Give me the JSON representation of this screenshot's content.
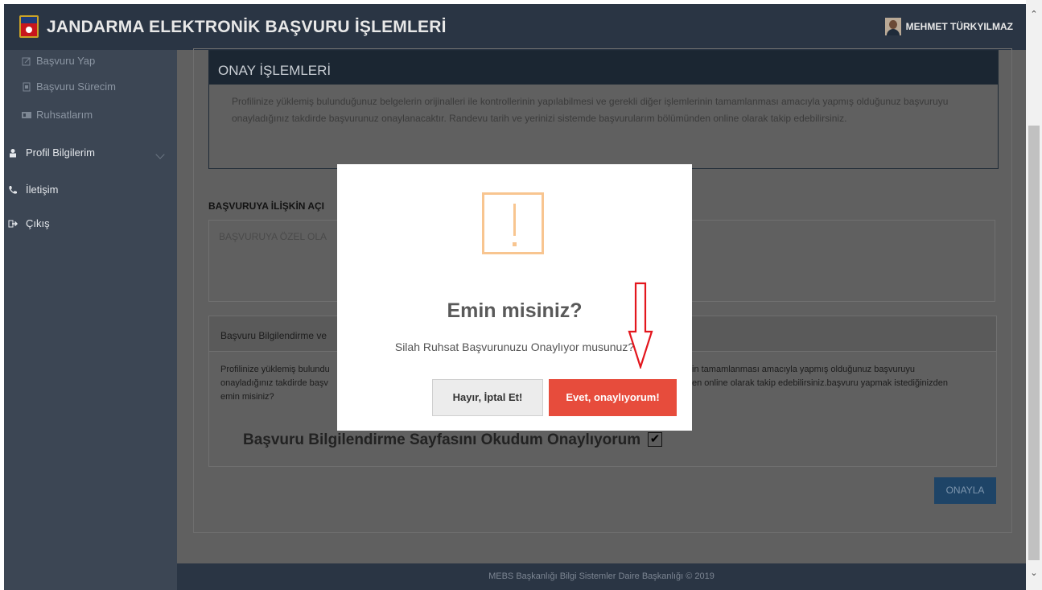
{
  "header": {
    "title": "JANDARMA ELEKTRONİK BAŞVURU İŞLEMLERİ",
    "user_name": "MEHMET TÜRKYILMAZ"
  },
  "sidebar": {
    "sub_items": [
      {
        "label": "Başvuru Yap",
        "icon": "edit-icon"
      },
      {
        "label": "Başvuru Sürecim",
        "icon": "file-icon"
      },
      {
        "label": "Ruhsatlarım",
        "icon": "id-card-icon"
      }
    ],
    "main_items": [
      {
        "label": "Profil Bilgilerim",
        "icon": "user-icon"
      },
      {
        "label": "İletişim",
        "icon": "phone-icon"
      },
      {
        "label": "Çıkış",
        "icon": "sign-out-icon"
      }
    ]
  },
  "main": {
    "onay_title": "ONAY İŞLEMLERİ",
    "onay_text": "Profilinize yüklemiş bulunduğunuz belgelerin orijinalleri ile kontrollerinin yapılabilmesi ve gerekli diğer işlemlerinin tamamlanması amacıyla yapmış olduğunuz başvuruyu onayladığınız takdirde başvurunuz onaylanacaktır. Randevu tarih ve yerinizi sistemde başvurularım bölümünden online olarak takip edebilirsiniz.",
    "aciklama_label": "BAŞVURUYA İLİŞKİN AÇI",
    "aciklama_placeholder": "BAŞVURUYA ÖZEL OLA",
    "bilgi_title": "Başvuru Bilgilendirme ve",
    "bilgi_text_left_1": "Profilinize yüklemiş bulundu",
    "bilgi_text_left_2": "onayladığınız takdirde başv",
    "bilgi_text_left_3": "emin misiniz?",
    "bilgi_text_right_1": "in tamamlanması amacıyla yapmış olduğunuz başvuruyu",
    "bilgi_text_right_2": "en online olarak takip edebilirsiniz.başvuru yapmak istediğinizden",
    "okudum_label": "Başvuru Bilgilendirme Sayfasını Okudum Onaylıyorum",
    "checkbox_checked": true,
    "onayla_label": "ONAYLA"
  },
  "footer": {
    "text": "MEBS Başkanlığı Bilgi Sistemler Daire Başkanlığı © 2019"
  },
  "modal": {
    "title": "Emin misiniz?",
    "message": "Silah Ruhsat Başvurunuzu Onaylıyor musunuz?",
    "cancel_label": "Hayır, İptal Et!",
    "confirm_label": "Evet, onaylıyorum!",
    "warning_icon": "warning-icon",
    "confirm_color": "#e74c3c"
  }
}
